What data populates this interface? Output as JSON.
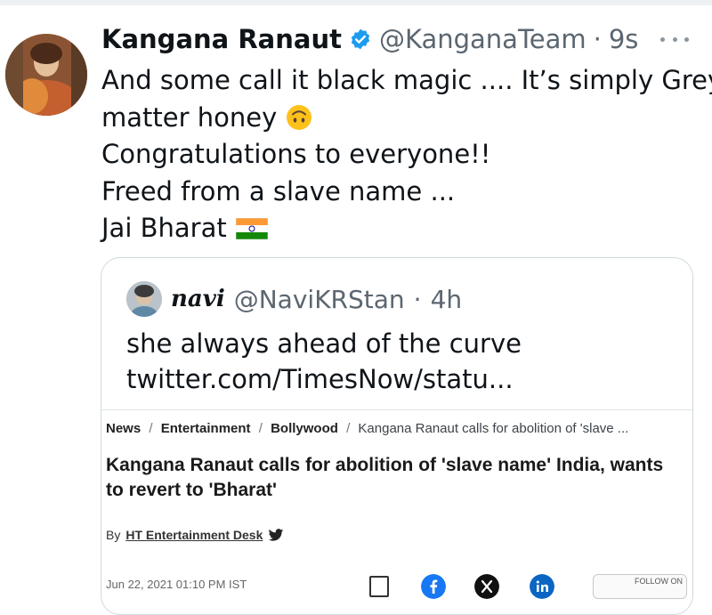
{
  "tweet": {
    "display_name": "Kangana Ranaut",
    "handle": "@KanganaTeam",
    "separator": "·",
    "time": "9s",
    "lines": [
      "And some call it black magic .... It’s simply Grey",
      "matter honey",
      "Congratulations to everyone!!",
      "Freed from a slave name ...",
      "Jai Bharat"
    ]
  },
  "quote": {
    "display_name": "navi",
    "handle": "@NaviKRStan",
    "separator": "·",
    "time": "4h",
    "lines": [
      "she always ahead of the curve",
      "twitter.com/TimesNow/statu..."
    ]
  },
  "article": {
    "breadcrumbs": [
      "News",
      "Entertainment",
      "Bollywood"
    ],
    "breadcrumb_sep": "/",
    "breadcrumb_current": "Kangana Ranaut calls for abolition of 'slave ...",
    "headline": "Kangana Ranaut calls for abolition of 'slave name' India, wants to revert to 'Bharat'",
    "byline_prefix": "By",
    "byline_author": "HT Entertainment Desk",
    "date": "Jun 22, 2021 01:10 PM IST",
    "follow_label": "FOLLOW ON"
  },
  "icons": {
    "verified": "verified-badge-icon",
    "more": "more-icon",
    "upside_down_face": "upside-down-face-emoji",
    "india_flag": "india-flag-emoji",
    "twitter": "twitter-bird-icon",
    "facebook": "facebook-icon",
    "x": "x-icon",
    "linkedin": "linkedin-icon",
    "bookmark": "bookmark-icon"
  },
  "colors": {
    "verified_blue": "#1d9bf0",
    "secondary_text": "#5b6670",
    "facebook_blue": "#1877f2",
    "linkedin_blue": "#0a66c2"
  }
}
